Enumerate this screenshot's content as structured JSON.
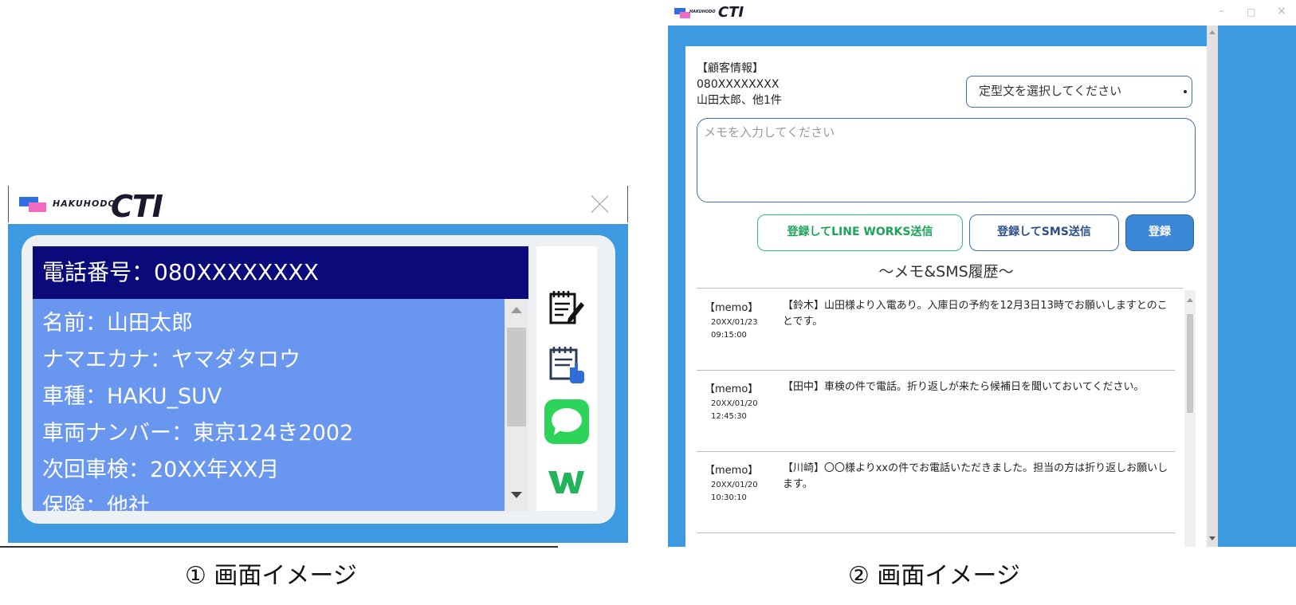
{
  "screen1": {
    "brand": "HAKUHODO",
    "app_name": "CTI",
    "phone_line": "電話番号：080XXXXXXXX",
    "info_lines": [
      "名前：山田太郎",
      "ナマエカナ：ヤマダタロウ",
      "車種：HAKU_SUV",
      "車両ナンバー：東京124き2002",
      "次回車検：20XX年XX月",
      "保険：他社"
    ],
    "icons": [
      "memo-edit-icon",
      "memo-click-icon",
      "sms-message-icon",
      "line-works-icon"
    ],
    "caption": "① 画面イメージ"
  },
  "screen2": {
    "brand": "HAKUHODO",
    "app_name": "CTI",
    "window_controls": [
      "–",
      "□",
      "×"
    ],
    "customer": {
      "heading": "【顧客情報】",
      "phone": "080XXXXXXXX",
      "name": "山田太郎、他1件"
    },
    "template_select": "定型文を選択してください",
    "memo_placeholder": "メモを入力してください",
    "buttons": {
      "line_works": "登録してLINE WORKS送信",
      "sms": "登録してSMS送信",
      "register": "登録"
    },
    "history_title": "～メモ&SMS履歴～",
    "history": [
      {
        "tag": "【memo】",
        "date": "20XX/01/23",
        "time": "09:15:00",
        "text": "【鈴木】山田様より入電あり。入庫日の予約を12月3日13時でお願いしますとのことです。"
      },
      {
        "tag": "【memo】",
        "date": "20XX/01/20",
        "time": "12:45:30",
        "text": "【田中】車検の件で電話。折り返しが来たら候補日を聞いておいてください。"
      },
      {
        "tag": "【memo】",
        "date": "20XX/01/20",
        "time": "10:30:10",
        "text": "【川崎】〇〇様よりxxの件でお電話いただきました。担当の方は折り返しお願いします。"
      }
    ],
    "caption": "② 画面イメージ"
  },
  "colors": {
    "title_bar_blue": "#3d9ae0",
    "phone_bar_navy": "#0a0a7a",
    "info_pane_blue": "#6996ee",
    "line_works_green": "#2cc36b",
    "register_blue": "#3d88d6"
  }
}
